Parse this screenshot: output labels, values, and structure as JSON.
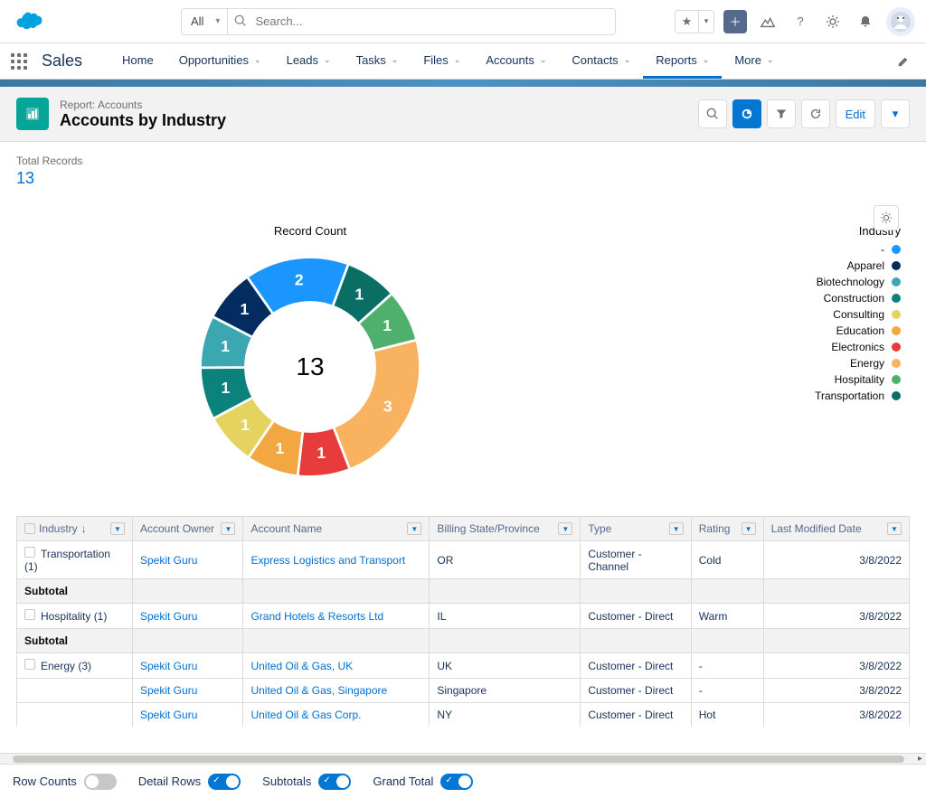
{
  "header": {
    "search_scope": "All",
    "search_placeholder": "Search..."
  },
  "app": {
    "name": "Sales",
    "nav_items": [
      {
        "label": "Home",
        "dropdown": false
      },
      {
        "label": "Opportunities",
        "dropdown": true
      },
      {
        "label": "Leads",
        "dropdown": true
      },
      {
        "label": "Tasks",
        "dropdown": true
      },
      {
        "label": "Files",
        "dropdown": true
      },
      {
        "label": "Accounts",
        "dropdown": true
      },
      {
        "label": "Contacts",
        "dropdown": true
      },
      {
        "label": "Reports",
        "dropdown": true,
        "active": true
      },
      {
        "label": "More",
        "dropdown": true
      }
    ]
  },
  "report": {
    "subtitle": "Report: Accounts",
    "title": "Accounts by Industry",
    "total_label": "Total Records",
    "total_value": "13",
    "edit_label": "Edit",
    "chart_title": "Record Count",
    "legend_title": "Industry"
  },
  "chart_data": {
    "type": "pie",
    "title": "Record Count",
    "center_label": "13",
    "total": 13,
    "legend_title": "Industry",
    "series": [
      {
        "name": "-",
        "value": 2,
        "color": "#1b96ff"
      },
      {
        "name": "Apparel",
        "value": 1,
        "color": "#032d60"
      },
      {
        "name": "Biotechnology",
        "value": 1,
        "color": "#3ba7b1"
      },
      {
        "name": "Construction",
        "value": 1,
        "color": "#0b827c"
      },
      {
        "name": "Consulting",
        "value": 1,
        "color": "#e4d35f"
      },
      {
        "name": "Education",
        "value": 1,
        "color": "#f2a742"
      },
      {
        "name": "Electronics",
        "value": 1,
        "color": "#e63c3c"
      },
      {
        "name": "Energy",
        "value": 3,
        "color": "#f9b25f"
      },
      {
        "name": "Hospitality",
        "value": 1,
        "color": "#4fb06d"
      },
      {
        "name": "Transportation",
        "value": 1,
        "color": "#0b6e65"
      }
    ]
  },
  "table": {
    "columns": [
      "Industry",
      "Account Owner",
      "Account Name",
      "Billing State/Province",
      "Type",
      "Rating",
      "Last Modified Date"
    ],
    "subtotal_label": "Subtotal",
    "groups": [
      {
        "group_label": "Transportation (1)",
        "rows": [
          {
            "owner": "Spekit Guru",
            "account": "Express Logistics and Transport",
            "state": "OR",
            "type": "Customer - Channel",
            "rating": "Cold",
            "date": "3/8/2022"
          }
        ]
      },
      {
        "group_label": "Hospitality (1)",
        "rows": [
          {
            "owner": "Spekit Guru",
            "account": "Grand Hotels & Resorts Ltd",
            "state": "IL",
            "type": "Customer - Direct",
            "rating": "Warm",
            "date": "3/8/2022"
          }
        ]
      },
      {
        "group_label": "Energy (3)",
        "rows": [
          {
            "owner": "Spekit Guru",
            "account": "United Oil & Gas, UK",
            "state": "UK",
            "type": "Customer - Direct",
            "rating": "-",
            "date": "3/8/2022"
          },
          {
            "owner": "Spekit Guru",
            "account": "United Oil & Gas, Singapore",
            "state": "Singapore",
            "type": "Customer - Direct",
            "rating": "-",
            "date": "3/8/2022"
          },
          {
            "owner": "Spekit Guru",
            "account": "United Oil & Gas Corp.",
            "state": "NY",
            "type": "Customer - Direct",
            "rating": "Hot",
            "date": "3/8/2022"
          }
        ]
      }
    ]
  },
  "footer": {
    "row_counts": "Row Counts",
    "detail_rows": "Detail Rows",
    "subtotals": "Subtotals",
    "grand_total": "Grand Total"
  }
}
